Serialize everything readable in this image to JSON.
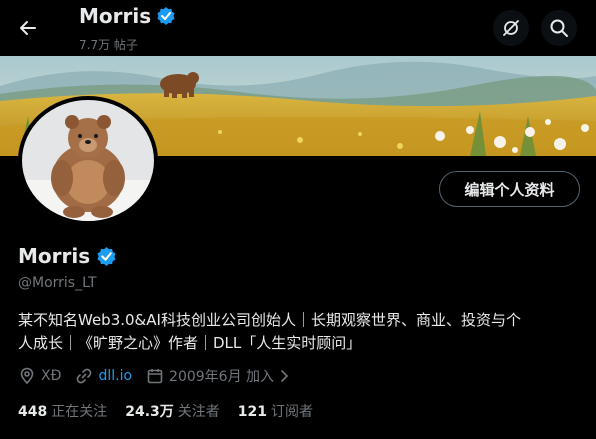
{
  "header": {
    "name": "Morris",
    "post_count": "7.7万 帖子"
  },
  "profile": {
    "display_name": "Morris",
    "handle": "@Morris_LT",
    "edit_button_label": "编辑个人资料",
    "bio_line1": "某不知名Web3.0&AI科技创业公司创始人｜长期观察世界、商业、投资与个",
    "bio_line2": "人成长｜《旷野之心》作者｜DLL「人生实时顾问」",
    "location": "XĐ",
    "website": "dll.io",
    "joined": "2009年6月 加入"
  },
  "stats": {
    "following_count": "448",
    "following_label": "正在关注",
    "followers_count": "24.3万",
    "followers_label": "关注者",
    "subscribers_count": "121",
    "subscribers_label": "订阅者"
  },
  "colors": {
    "background": "#000000",
    "text": "#e7e9ea",
    "muted": "#71767b",
    "accent": "#1d9bf0",
    "verified": "#1d9bf0"
  },
  "icons": [
    "back-arrow-icon",
    "verified-badge-icon",
    "grok-icon",
    "search-icon",
    "location-icon",
    "link-icon",
    "calendar-icon",
    "chevron-right-icon"
  ]
}
